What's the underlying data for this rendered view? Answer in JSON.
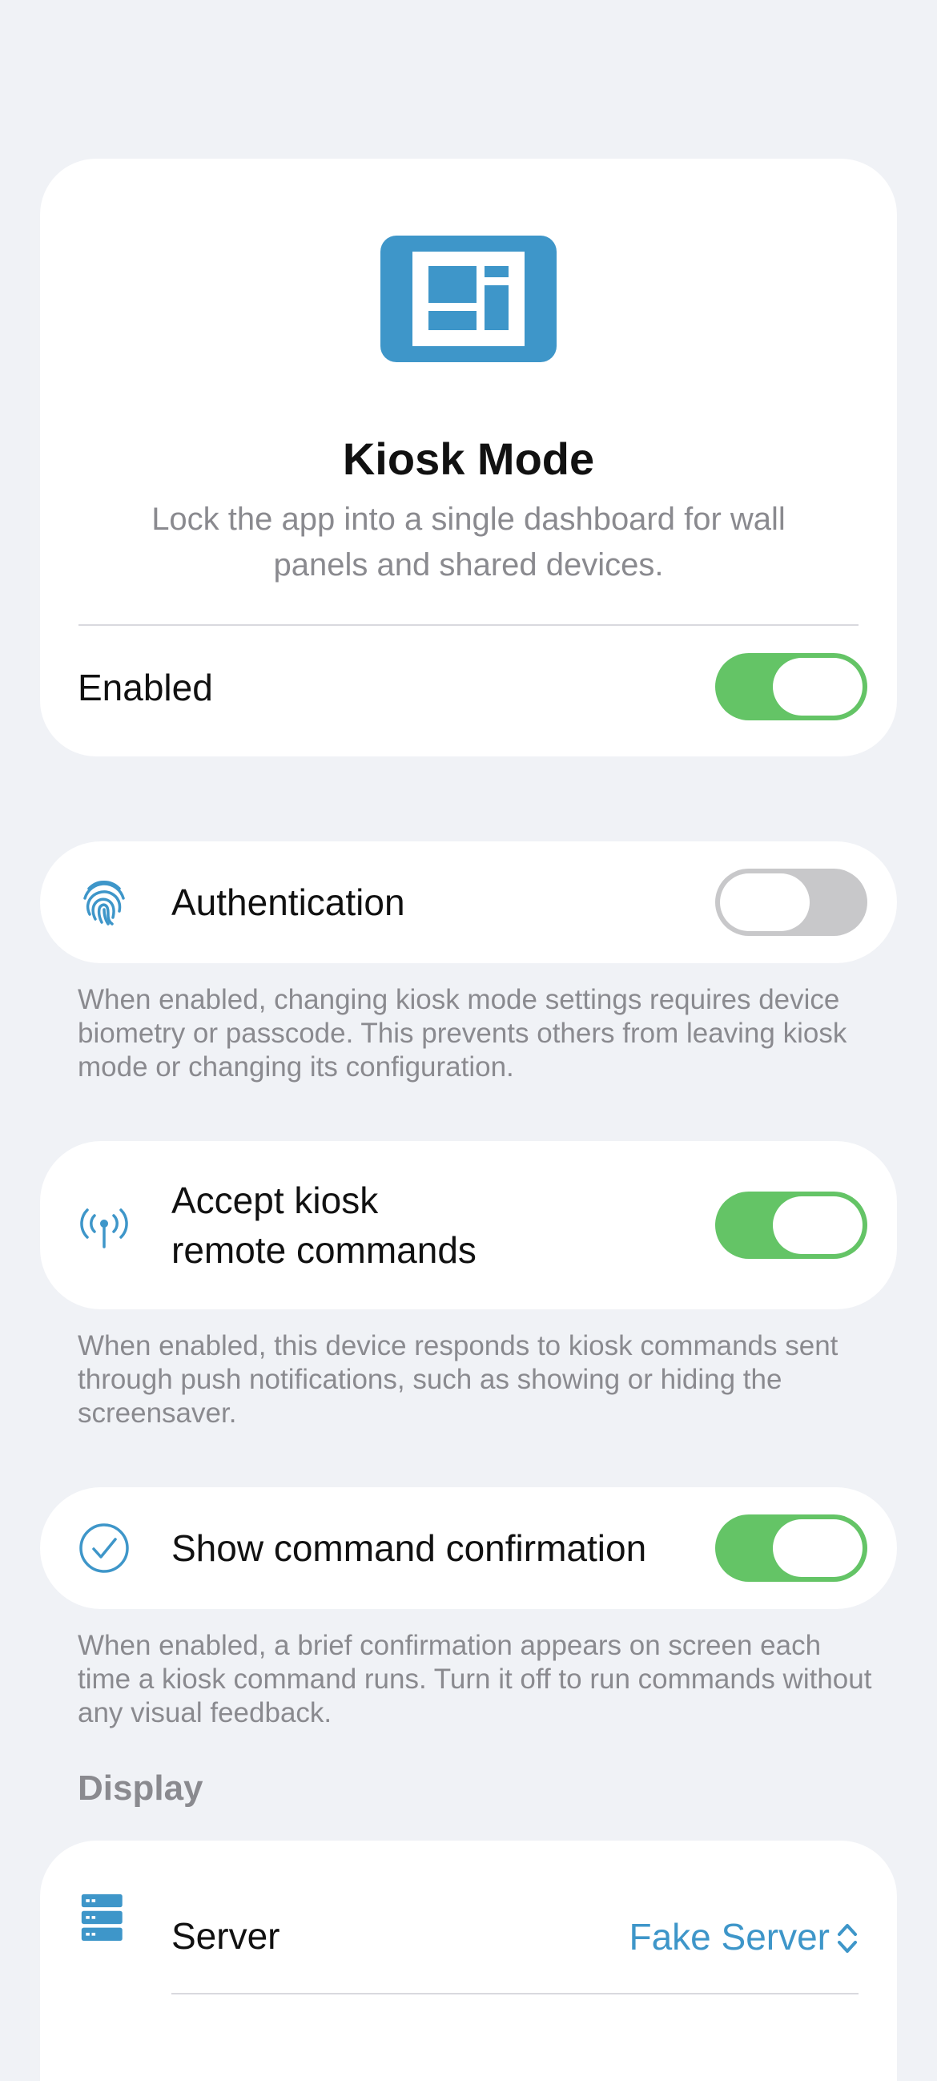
{
  "hero": {
    "icon": "kiosk-dashboard-icon",
    "title": "Kiosk Mode",
    "subtitle": "Lock the app into a single dashboard for wall panels and shared devices.",
    "enabled_label": "Enabled",
    "enabled": true
  },
  "settings": {
    "authentication": {
      "icon": "fingerprint-icon",
      "label": "Authentication",
      "enabled": false,
      "footnote": "When enabled, changing kiosk mode settings requires device biometry or passcode. This prevents others from leaving kiosk mode or changing its configuration."
    },
    "remote_commands": {
      "icon": "antenna-icon",
      "label_line1": "Accept kiosk",
      "label_line2": "remote commands",
      "enabled": true,
      "footnote": "When enabled, this device responds to kiosk commands sent through push notifications, such as showing or hiding the screensaver."
    },
    "command_confirmation": {
      "icon": "checkmark-circle-icon",
      "label": "Show command confirmation",
      "enabled": true,
      "footnote": "When enabled, a brief confirmation appears on screen each time a kiosk command runs. Turn it off to run commands without any visual feedback."
    }
  },
  "display": {
    "header": "Display",
    "server": {
      "icon": "server-icon",
      "label": "Server",
      "value": "Fake Server"
    }
  },
  "colors": {
    "accent": "#3e96c9",
    "toggle_on": "#64c466",
    "toggle_off": "#c8c8ca",
    "background": "#f0f2f6",
    "secondary_text": "#8a8a8f"
  }
}
